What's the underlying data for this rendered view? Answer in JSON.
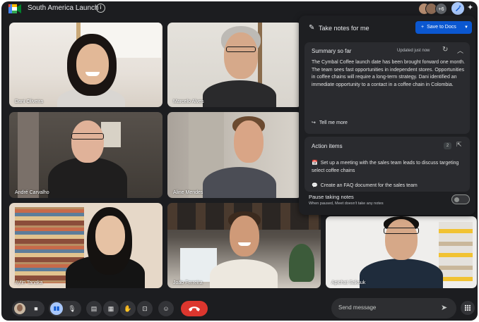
{
  "header": {
    "meeting_title": "South America Launch",
    "participants_extra": "+6"
  },
  "participants": [
    {
      "name": "Dani Oliveira"
    },
    {
      "name": "Marcelo Alves"
    },
    {
      "name": "André Carvalho"
    },
    {
      "name": "Aline Mendes"
    },
    {
      "name": "Aylin Tanaka"
    },
    {
      "name": "João Ferreira"
    },
    {
      "name": "Apichat Saksuk"
    }
  ],
  "notes_panel": {
    "title": "Take notes for me",
    "save_button": "Save to Docs",
    "summary": {
      "title": "Summary so far",
      "updated": "Updated just now",
      "text": "The Cymbal Coffee launch date has been brought forward one month. The team sees fast opportunities in independent stores. Opportunities in coffee chains will require a long-term strategy. Dani identified an immediate opportunity to a contact in a coffee chain in Colombia.",
      "tell_more": "Tell me more"
    },
    "actions": {
      "title": "Action items",
      "count": "2",
      "items": [
        "Set up a meeting with the sales team leads to discuss targeting select coffee chains",
        "Create an FAQ document for the sales team"
      ]
    },
    "pause": {
      "title": "Pause taking notes",
      "subtitle": "When paused, Meet doesn't take any notes"
    }
  },
  "bottom_bar": {
    "message_placeholder": "Send message"
  },
  "colors": {
    "background": "#1c1d20",
    "panel": "#1e1f22",
    "card": "#2a2b2f",
    "primary_button": "#0b57d0",
    "mic_active": "#a8c7fa",
    "end_call": "#dc362e"
  }
}
